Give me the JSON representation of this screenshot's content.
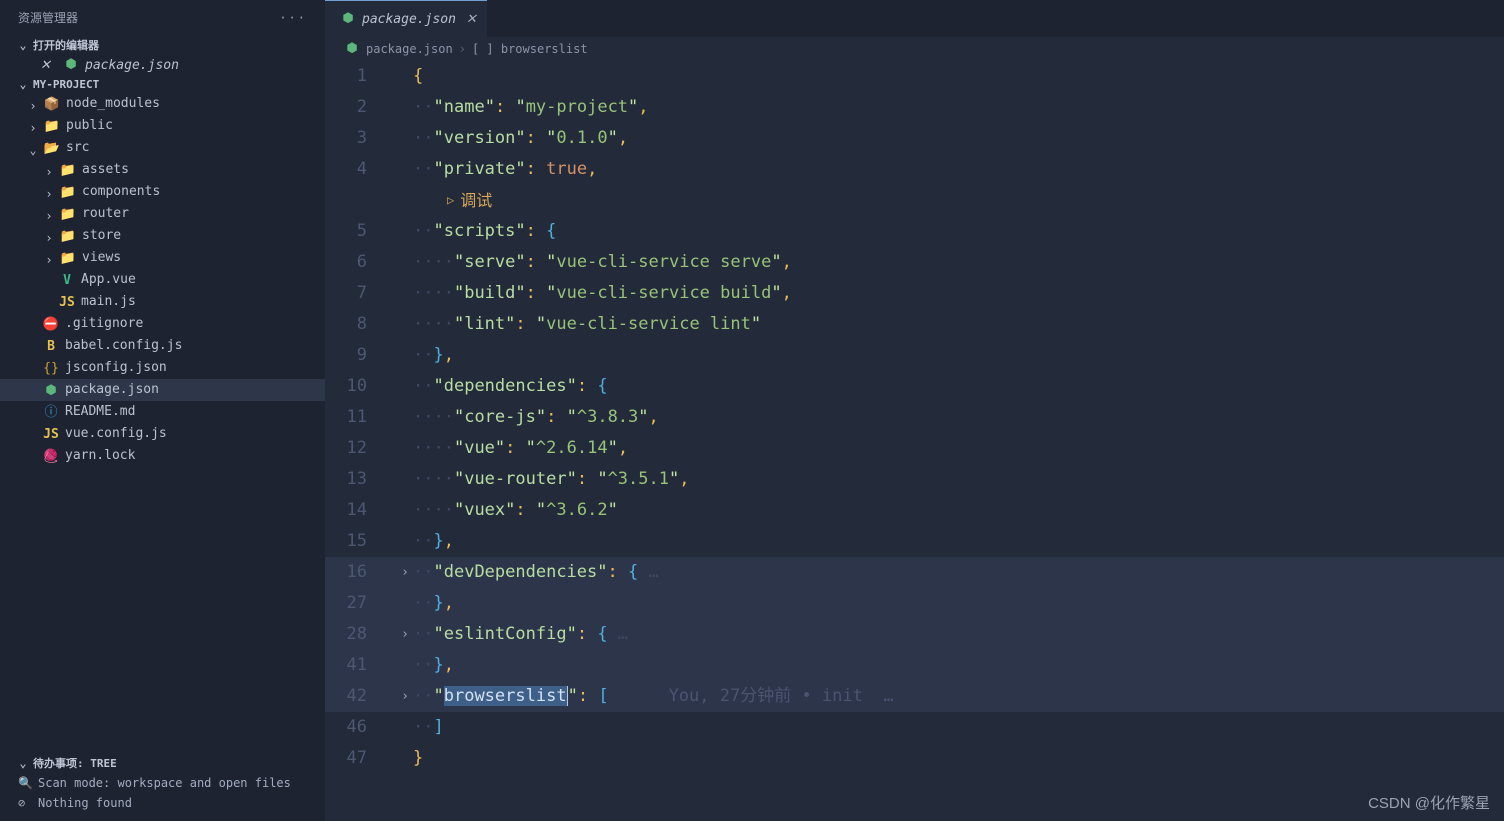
{
  "sidebar": {
    "title": "资源管理器",
    "dots": "···",
    "openEditors": {
      "title": "打开的编辑器",
      "items": [
        {
          "label": "package.json"
        }
      ]
    },
    "project": {
      "title": "MY-PROJECT",
      "tree": [
        {
          "depth": 1,
          "open": false,
          "type": "folder",
          "label": "node_modules",
          "icon": "📦",
          "cls": "ic-folder"
        },
        {
          "depth": 1,
          "open": false,
          "type": "folder",
          "label": "public",
          "icon": "📁",
          "cls": "ic-folder"
        },
        {
          "depth": 1,
          "open": true,
          "type": "folder",
          "label": "src",
          "icon": "📂",
          "cls": "ic-folder-open"
        },
        {
          "depth": 2,
          "open": false,
          "type": "folder",
          "label": "assets",
          "icon": "📁",
          "cls": "ic-folder"
        },
        {
          "depth": 2,
          "open": false,
          "type": "folder",
          "label": "components",
          "icon": "📁",
          "cls": "ic-folder"
        },
        {
          "depth": 2,
          "open": false,
          "type": "folder",
          "label": "router",
          "icon": "📁",
          "cls": "ic-folder"
        },
        {
          "depth": 2,
          "open": false,
          "type": "folder",
          "label": "store",
          "icon": "📁",
          "cls": "ic-folder"
        },
        {
          "depth": 2,
          "open": false,
          "type": "folder",
          "label": "views",
          "icon": "📁",
          "cls": "ic-folder"
        },
        {
          "depth": 2,
          "type": "file",
          "label": "App.vue",
          "icon": "V",
          "cls": "ic-vue"
        },
        {
          "depth": 2,
          "type": "file",
          "label": "main.js",
          "icon": "JS",
          "cls": "ic-js"
        },
        {
          "depth": 1,
          "type": "file",
          "label": ".gitignore",
          "icon": "⛔",
          "cls": "ic-git"
        },
        {
          "depth": 1,
          "type": "file",
          "label": "babel.config.js",
          "icon": "B",
          "cls": "ic-js"
        },
        {
          "depth": 1,
          "type": "file",
          "label": "jsconfig.json",
          "icon": "{}",
          "cls": "ic-json"
        },
        {
          "depth": 1,
          "type": "file",
          "label": "package.json",
          "icon": "⬢",
          "cls": "ic-npm",
          "selected": true
        },
        {
          "depth": 1,
          "type": "file",
          "label": "README.md",
          "icon": "ⓘ",
          "cls": "ic-info"
        },
        {
          "depth": 1,
          "type": "file",
          "label": "vue.config.js",
          "icon": "JS",
          "cls": "ic-js"
        },
        {
          "depth": 1,
          "type": "file",
          "label": "yarn.lock",
          "icon": "🧶",
          "cls": "ic-yarn"
        }
      ]
    },
    "bottom": {
      "section": "待办事项: TREE",
      "scan": "Scan mode: workspace and open files",
      "nothing": "Nothing found"
    }
  },
  "tab": {
    "label": "package.json"
  },
  "breadcrumb": {
    "file": "package.json",
    "key": "browserslist",
    "arrIcon": "[ ]"
  },
  "codelens": {
    "debug": "调试"
  },
  "blame": "You, 27分钟前 • init  …",
  "lines": [
    {
      "n": 1,
      "html": "<span class='punct'>{</span>"
    },
    {
      "n": 2,
      "html": "<span class='ws'>··</span><span class='kq'>\"</span><span class='key'>name</span><span class='kq'>\"</span><span class='punct'>:</span> <span class='kq'>\"</span><span class='str'>my-project</span><span class='kq'>\"</span><span class='punct'>,</span>"
    },
    {
      "n": 3,
      "html": "<span class='ws'>··</span><span class='kq'>\"</span><span class='key'>version</span><span class='kq'>\"</span><span class='punct'>:</span> <span class='kq'>\"</span><span class='str'>0.1.0</span><span class='kq'>\"</span><span class='punct'>,</span>"
    },
    {
      "n": 4,
      "html": "<span class='ws'>··</span><span class='kq'>\"</span><span class='key'>private</span><span class='kq'>\"</span><span class='punct'>:</span> <span class='bool'>true</span><span class='punct'>,</span>"
    },
    {
      "lens": true
    },
    {
      "n": 5,
      "html": "<span class='ws'>··</span><span class='kq'>\"</span><span class='key'>scripts</span><span class='kq'>\"</span><span class='punct'>:</span> <span class='brack'>{</span>"
    },
    {
      "n": 6,
      "html": "<span class='ws'>····</span><span class='kq'>\"</span><span class='key'>serve</span><span class='kq'>\"</span><span class='punct'>:</span> <span class='kq'>\"</span><span class='str'>vue-cli-service serve</span><span class='kq'>\"</span><span class='punct'>,</span>"
    },
    {
      "n": 7,
      "html": "<span class='ws'>····</span><span class='kq'>\"</span><span class='key'>build</span><span class='kq'>\"</span><span class='punct'>:</span> <span class='kq'>\"</span><span class='str'>vue-cli-service build</span><span class='kq'>\"</span><span class='punct'>,</span>"
    },
    {
      "n": 8,
      "html": "<span class='ws'>····</span><span class='kq'>\"</span><span class='key'>lint</span><span class='kq'>\"</span><span class='punct'>:</span> <span class='kq'>\"</span><span class='str'>vue-cli-service lint</span><span class='kq'>\"</span>"
    },
    {
      "n": 9,
      "html": "<span class='ws'>··</span><span class='brack'>}</span><span class='punct'>,</span>"
    },
    {
      "n": 10,
      "html": "<span class='ws'>··</span><span class='kq'>\"</span><span class='key'>dependencies</span><span class='kq'>\"</span><span class='punct'>:</span> <span class='brack'>{</span>"
    },
    {
      "n": 11,
      "html": "<span class='ws'>····</span><span class='kq'>\"</span><span class='key'>core-js</span><span class='kq'>\"</span><span class='punct'>:</span> <span class='kq'>\"</span><span class='str'>^3.8.3</span><span class='kq'>\"</span><span class='punct'>,</span>"
    },
    {
      "n": 12,
      "html": "<span class='ws'>····</span><span class='kq'>\"</span><span class='key'>vue</span><span class='kq'>\"</span><span class='punct'>:</span> <span class='kq'>\"</span><span class='str'>^2.6.14</span><span class='kq'>\"</span><span class='punct'>,</span>"
    },
    {
      "n": 13,
      "html": "<span class='ws'>····</span><span class='kq'>\"</span><span class='key'>vue-router</span><span class='kq'>\"</span><span class='punct'>:</span> <span class='kq'>\"</span><span class='str'>^3.5.1</span><span class='kq'>\"</span><span class='punct'>,</span>"
    },
    {
      "n": 14,
      "html": "<span class='ws'>····</span><span class='kq'>\"</span><span class='key'>vuex</span><span class='kq'>\"</span><span class='punct'>:</span> <span class='kq'>\"</span><span class='str'>^3.6.2</span><span class='kq'>\"</span>"
    },
    {
      "n": 15,
      "html": "<span class='ws'>··</span><span class='brack'>}</span><span class='punct'>,</span>"
    },
    {
      "n": 16,
      "fold": true,
      "hl": true,
      "html": "<span class='ws'>··</span><span class='kq'>\"</span><span class='key'>devDependencies</span><span class='kq'>\"</span><span class='punct'>:</span> <span class='brack'>{</span><span class='ws'> …</span>"
    },
    {
      "n": 27,
      "hl": true,
      "html": "<span class='ws'>··</span><span class='brack'>}</span><span class='punct'>,</span>"
    },
    {
      "n": 28,
      "fold": true,
      "hl": true,
      "html": "<span class='ws'>··</span><span class='kq'>\"</span><span class='key'>eslintConfig</span><span class='kq'>\"</span><span class='punct'>:</span> <span class='brack'>{</span><span class='ws'> …</span>"
    },
    {
      "n": 41,
      "hl": true,
      "html": "<span class='ws'>··</span><span class='brack'>}</span><span class='punct'>,</span>"
    },
    {
      "n": 42,
      "fold": true,
      "hl": true,
      "current": true,
      "html": "<span class='ws'>··</span><span class='kq'>\"</span><span class='selkey'>browserslist</span><span class='cursor-caret'></span><span class='kq'>\"</span><span class='punct'>:</span> <span class='brack'>[</span>",
      "blame": true
    },
    {
      "n": 46,
      "html": "<span class='ws'>··</span><span class='brack'>]</span>"
    },
    {
      "n": 47,
      "html": "<span class='punct'>}</span>"
    }
  ],
  "watermark": "CSDN @化作繁星"
}
